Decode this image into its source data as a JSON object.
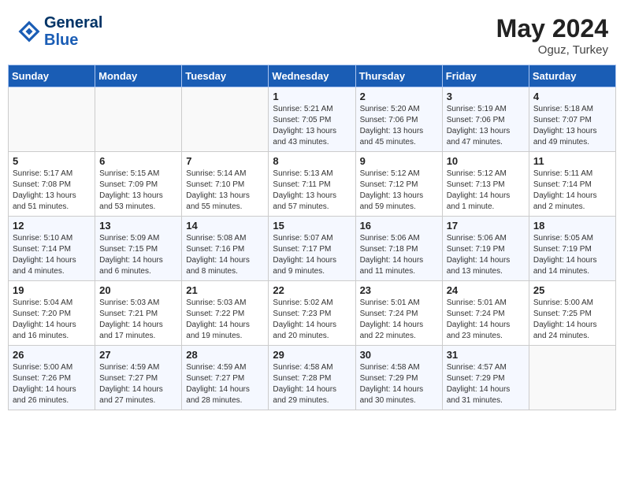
{
  "header": {
    "logo_line1": "General",
    "logo_line2": "Blue",
    "month_year": "May 2024",
    "location": "Oguz, Turkey"
  },
  "weekdays": [
    "Sunday",
    "Monday",
    "Tuesday",
    "Wednesday",
    "Thursday",
    "Friday",
    "Saturday"
  ],
  "weeks": [
    [
      {
        "day": "",
        "info": ""
      },
      {
        "day": "",
        "info": ""
      },
      {
        "day": "",
        "info": ""
      },
      {
        "day": "1",
        "info": "Sunrise: 5:21 AM\nSunset: 7:05 PM\nDaylight: 13 hours\nand 43 minutes."
      },
      {
        "day": "2",
        "info": "Sunrise: 5:20 AM\nSunset: 7:06 PM\nDaylight: 13 hours\nand 45 minutes."
      },
      {
        "day": "3",
        "info": "Sunrise: 5:19 AM\nSunset: 7:06 PM\nDaylight: 13 hours\nand 47 minutes."
      },
      {
        "day": "4",
        "info": "Sunrise: 5:18 AM\nSunset: 7:07 PM\nDaylight: 13 hours\nand 49 minutes."
      }
    ],
    [
      {
        "day": "5",
        "info": "Sunrise: 5:17 AM\nSunset: 7:08 PM\nDaylight: 13 hours\nand 51 minutes."
      },
      {
        "day": "6",
        "info": "Sunrise: 5:15 AM\nSunset: 7:09 PM\nDaylight: 13 hours\nand 53 minutes."
      },
      {
        "day": "7",
        "info": "Sunrise: 5:14 AM\nSunset: 7:10 PM\nDaylight: 13 hours\nand 55 minutes."
      },
      {
        "day": "8",
        "info": "Sunrise: 5:13 AM\nSunset: 7:11 PM\nDaylight: 13 hours\nand 57 minutes."
      },
      {
        "day": "9",
        "info": "Sunrise: 5:12 AM\nSunset: 7:12 PM\nDaylight: 13 hours\nand 59 minutes."
      },
      {
        "day": "10",
        "info": "Sunrise: 5:12 AM\nSunset: 7:13 PM\nDaylight: 14 hours\nand 1 minute."
      },
      {
        "day": "11",
        "info": "Sunrise: 5:11 AM\nSunset: 7:14 PM\nDaylight: 14 hours\nand 2 minutes."
      }
    ],
    [
      {
        "day": "12",
        "info": "Sunrise: 5:10 AM\nSunset: 7:14 PM\nDaylight: 14 hours\nand 4 minutes."
      },
      {
        "day": "13",
        "info": "Sunrise: 5:09 AM\nSunset: 7:15 PM\nDaylight: 14 hours\nand 6 minutes."
      },
      {
        "day": "14",
        "info": "Sunrise: 5:08 AM\nSunset: 7:16 PM\nDaylight: 14 hours\nand 8 minutes."
      },
      {
        "day": "15",
        "info": "Sunrise: 5:07 AM\nSunset: 7:17 PM\nDaylight: 14 hours\nand 9 minutes."
      },
      {
        "day": "16",
        "info": "Sunrise: 5:06 AM\nSunset: 7:18 PM\nDaylight: 14 hours\nand 11 minutes."
      },
      {
        "day": "17",
        "info": "Sunrise: 5:06 AM\nSunset: 7:19 PM\nDaylight: 14 hours\nand 13 minutes."
      },
      {
        "day": "18",
        "info": "Sunrise: 5:05 AM\nSunset: 7:19 PM\nDaylight: 14 hours\nand 14 minutes."
      }
    ],
    [
      {
        "day": "19",
        "info": "Sunrise: 5:04 AM\nSunset: 7:20 PM\nDaylight: 14 hours\nand 16 minutes."
      },
      {
        "day": "20",
        "info": "Sunrise: 5:03 AM\nSunset: 7:21 PM\nDaylight: 14 hours\nand 17 minutes."
      },
      {
        "day": "21",
        "info": "Sunrise: 5:03 AM\nSunset: 7:22 PM\nDaylight: 14 hours\nand 19 minutes."
      },
      {
        "day": "22",
        "info": "Sunrise: 5:02 AM\nSunset: 7:23 PM\nDaylight: 14 hours\nand 20 minutes."
      },
      {
        "day": "23",
        "info": "Sunrise: 5:01 AM\nSunset: 7:24 PM\nDaylight: 14 hours\nand 22 minutes."
      },
      {
        "day": "24",
        "info": "Sunrise: 5:01 AM\nSunset: 7:24 PM\nDaylight: 14 hours\nand 23 minutes."
      },
      {
        "day": "25",
        "info": "Sunrise: 5:00 AM\nSunset: 7:25 PM\nDaylight: 14 hours\nand 24 minutes."
      }
    ],
    [
      {
        "day": "26",
        "info": "Sunrise: 5:00 AM\nSunset: 7:26 PM\nDaylight: 14 hours\nand 26 minutes."
      },
      {
        "day": "27",
        "info": "Sunrise: 4:59 AM\nSunset: 7:27 PM\nDaylight: 14 hours\nand 27 minutes."
      },
      {
        "day": "28",
        "info": "Sunrise: 4:59 AM\nSunset: 7:27 PM\nDaylight: 14 hours\nand 28 minutes."
      },
      {
        "day": "29",
        "info": "Sunrise: 4:58 AM\nSunset: 7:28 PM\nDaylight: 14 hours\nand 29 minutes."
      },
      {
        "day": "30",
        "info": "Sunrise: 4:58 AM\nSunset: 7:29 PM\nDaylight: 14 hours\nand 30 minutes."
      },
      {
        "day": "31",
        "info": "Sunrise: 4:57 AM\nSunset: 7:29 PM\nDaylight: 14 hours\nand 31 minutes."
      },
      {
        "day": "",
        "info": ""
      }
    ]
  ]
}
